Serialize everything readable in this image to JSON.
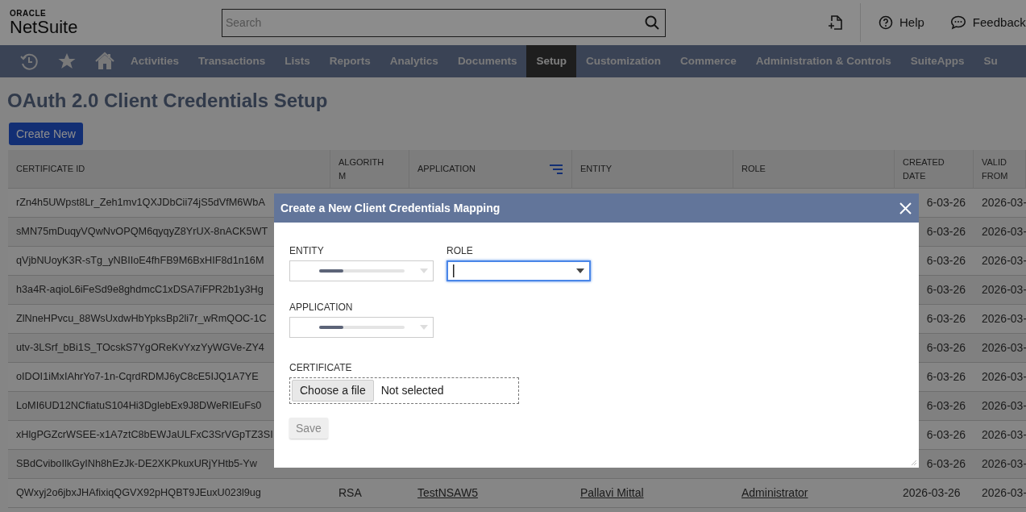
{
  "header": {
    "logo": {
      "company": "ORACLE",
      "product": "NetSuite"
    },
    "search": {
      "placeholder": "Search"
    },
    "actions": [
      {
        "kind": "help",
        "label": "Help"
      },
      {
        "kind": "feedback",
        "label": "Feedback"
      }
    ]
  },
  "nav": {
    "items": [
      {
        "label": "Activities",
        "selected": false
      },
      {
        "label": "Transactions",
        "selected": false
      },
      {
        "label": "Lists",
        "selected": false
      },
      {
        "label": "Reports",
        "selected": false
      },
      {
        "label": "Analytics",
        "selected": false
      },
      {
        "label": "Documents",
        "selected": false
      },
      {
        "label": "Setup",
        "selected": true
      },
      {
        "label": "Customization",
        "selected": false
      },
      {
        "label": "Commerce",
        "selected": false
      },
      {
        "label": "Administration & Controls",
        "selected": false
      },
      {
        "label": "SuiteApps",
        "selected": false
      },
      {
        "label": "Su",
        "selected": false
      }
    ]
  },
  "page": {
    "title": "OAuth 2.0 Client Credentials Setup",
    "create_button": "Create New"
  },
  "table": {
    "columns": [
      {
        "label": "CERTIFICATE ID",
        "filtered": false
      },
      {
        "label": "ALGORITH M",
        "filtered": false
      },
      {
        "label": "APPLICATION",
        "filtered": true
      },
      {
        "label": "ENTITY",
        "filtered": false
      },
      {
        "label": "ROLE",
        "filtered": false
      },
      {
        "label": "CREATED DATE",
        "filtered": false
      },
      {
        "label": "VALID FROM",
        "filtered": false
      }
    ],
    "rows": [
      {
        "certificate_id": "rZn4h5UWpst8Lr_Zeh1mv1QXJDbCii74jS5dVfM6WbA",
        "created_date": "6-03-26",
        "valid_from": "2026-03-"
      },
      {
        "certificate_id": "sMN75mDuqyVQwNvOPQM6qyqyZ8YrUX-8nACK5WT",
        "created_date": "6-03-26",
        "valid_from": "2026-03-"
      },
      {
        "certificate_id": "qVjbNUoyK3R-sTg_yNBIIoE4fhFB9M6BxHIF8d1n16M",
        "created_date": "6-03-26",
        "valid_from": "2026-03-"
      },
      {
        "certificate_id": "h3a4R-aqioL6iFeSd9e8ghdmcC1xDSA7iFPR2b1y3Hg",
        "created_date": "6-03-26",
        "valid_from": "2026-03-"
      },
      {
        "certificate_id": "ZlNneHPvcu_88WsUxdwHbYpksBp2li7r_wRmQOC-1C",
        "created_date": "6-03-26",
        "valid_from": "2026-03-"
      },
      {
        "certificate_id": "utv-3LSrf_bBi1S_TOcskS7YgOReKvYxzYyWGVe-ZY4",
        "created_date": "6-03-26",
        "valid_from": "2026-03-"
      },
      {
        "certificate_id": "oIDOI1iMxIAhrYo7-1n-CqrdRDMJ6yC8cE5IJQ1A7YE",
        "created_date": "6-03-26",
        "valid_from": "2026-03-"
      },
      {
        "certificate_id": "LoMI6UD12NCfiatuS104Hi3DglebEx9J8DWeRIEuFs0",
        "created_date": "6-03-26",
        "valid_from": "2026-03-"
      },
      {
        "certificate_id": "xHlgPGZcrWSEE-x1A7ztC8bEWJaULFxC3SrVGpTZ3SI",
        "created_date": "6-03-26",
        "valid_from": "2026-03-"
      },
      {
        "certificate_id": "SBdCviboIlkGyINh8hEzJk-DE2XKPkuxURjYHtb5-Yw",
        "created_date": "6-03-26",
        "valid_from": "2026-03-"
      },
      {
        "certificate_id": "QWxyj2o6jbxJHAfixiqQGVX92pHQBT9JEuxU023l9ug",
        "algorithm": "RSA",
        "application": "TestNSAW5",
        "entity": "Pallavi Mittal",
        "role": "Administrator",
        "created_date": "2026-03-26",
        "valid_from": "2026-03-"
      }
    ]
  },
  "dialog": {
    "title": "Create a New Client Credentials Mapping",
    "fields": [
      {
        "label": "ENTITY",
        "kind": "loading",
        "focused": false
      },
      {
        "label": "ROLE",
        "kind": "select",
        "focused": true
      },
      {
        "label": "APPLICATION",
        "kind": "loading",
        "focused": false
      }
    ],
    "certificate": {
      "label": "CERTIFICATE",
      "button": "Choose a file",
      "status": "Not selected"
    },
    "save": {
      "label": "Save",
      "disabled": true
    }
  }
}
